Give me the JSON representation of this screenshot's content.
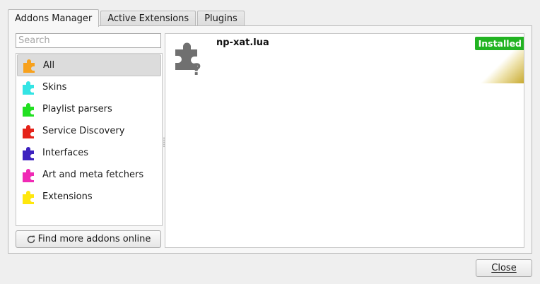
{
  "tabs": [
    {
      "label": "Addons Manager",
      "active": true
    },
    {
      "label": "Active Extensions",
      "active": false
    },
    {
      "label": "Plugins",
      "active": false
    }
  ],
  "search": {
    "placeholder": "Search",
    "value": ""
  },
  "categories": [
    {
      "label": "All",
      "color": "#f7a11d",
      "selected": true
    },
    {
      "label": "Skins",
      "color": "#34e4e4",
      "selected": false
    },
    {
      "label": "Playlist parsers",
      "color": "#22e022",
      "selected": false
    },
    {
      "label": "Service Discovery",
      "color": "#e5231a",
      "selected": false
    },
    {
      "label": "Interfaces",
      "color": "#3d21bf",
      "selected": false
    },
    {
      "label": "Art and meta fetchers",
      "color": "#f02ab5",
      "selected": false
    },
    {
      "label": "Extensions",
      "color": "#ffe70d",
      "selected": false
    }
  ],
  "find_more_label": "Find more addons online",
  "addons": [
    {
      "name": "np-xat.lua",
      "status": "Installed",
      "icon": "unknown-addon-puzzle-icon",
      "status_color": "#22b322"
    }
  ],
  "close_label": "Close"
}
